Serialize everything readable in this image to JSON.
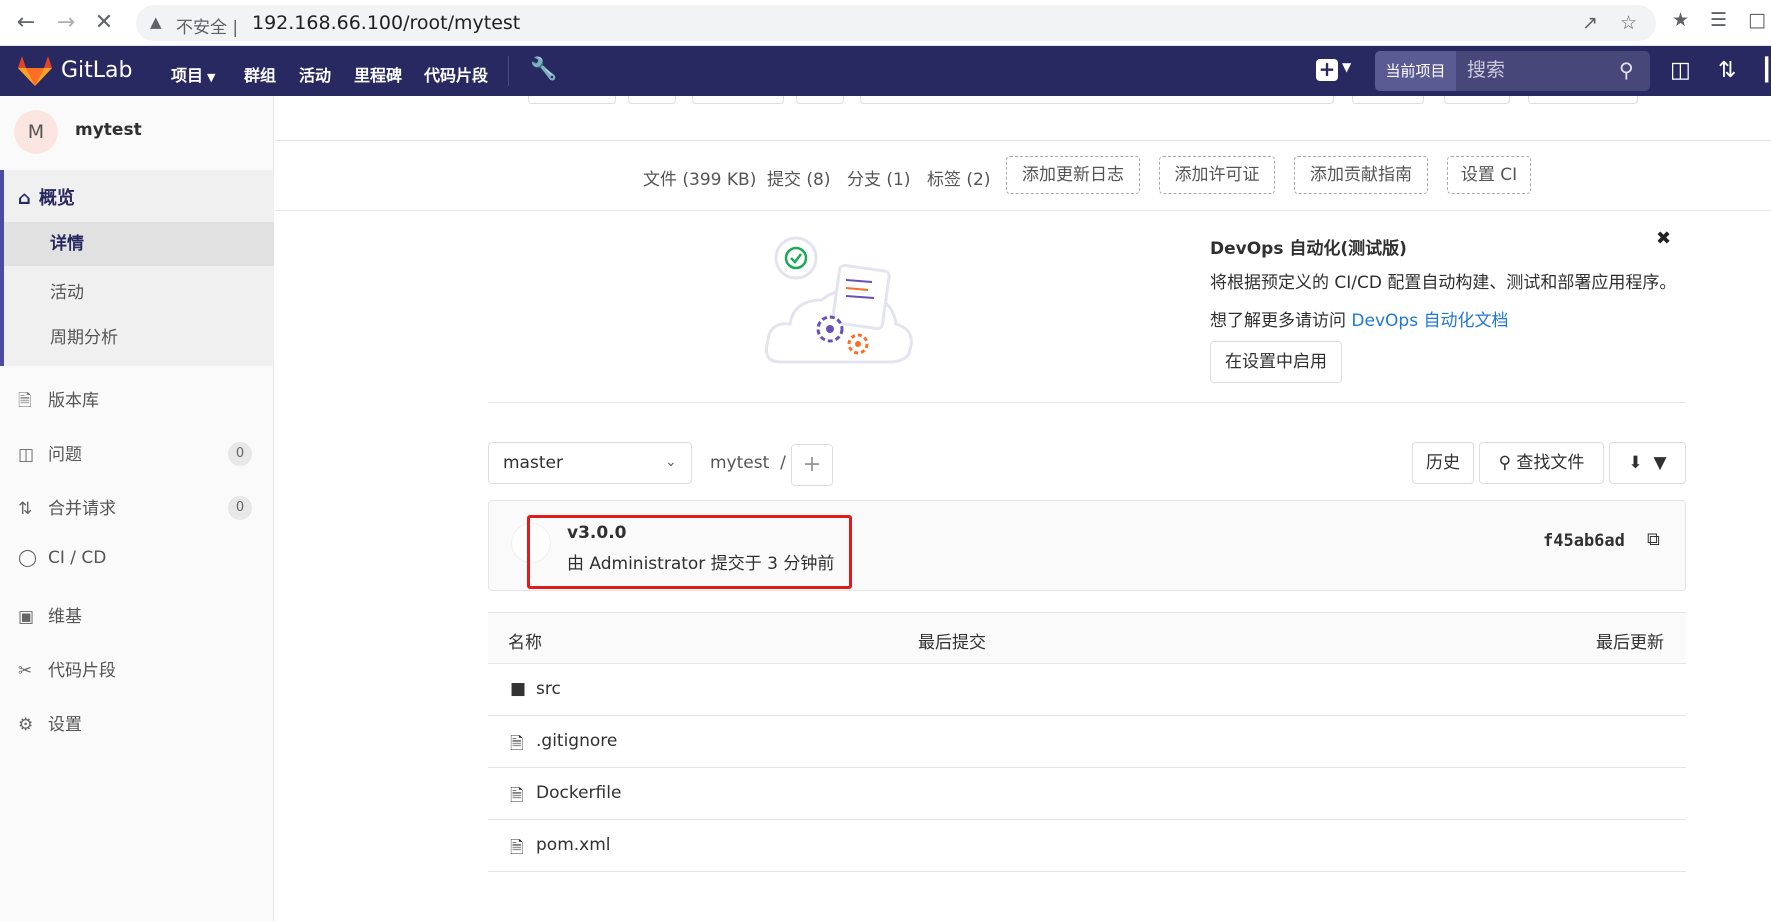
{
  "browser": {
    "insecure_label": "不安全 |",
    "url": "192.168.66.100/root/mytest"
  },
  "header": {
    "brand": "GitLab",
    "nav": [
      "项目",
      "群组",
      "活动",
      "里程碑",
      "代码片段"
    ],
    "search_scope": "当前项目",
    "search_placeholder": "搜索"
  },
  "sidebar": {
    "avatar_letter": "M",
    "project_name": "mytest",
    "overview": "概览",
    "overview_items": [
      "详情",
      "活动",
      "周期分析"
    ],
    "items": [
      {
        "label": "版本库",
        "icon": "document-icon"
      },
      {
        "label": "问题",
        "icon": "issues-icon",
        "badge": "0"
      },
      {
        "label": "合并请求",
        "icon": "merge-request-icon",
        "badge": "0"
      },
      {
        "label": "CI / CD",
        "icon": "rocket-icon"
      },
      {
        "label": "维基",
        "icon": "book-icon"
      },
      {
        "label": "代码片段",
        "icon": "scissors-icon"
      },
      {
        "label": "设置",
        "icon": "gear-icon"
      }
    ]
  },
  "stats": {
    "files": "文件 (399 KB)",
    "commits": "提交 (8)",
    "branches": "分支 (1)",
    "tags": "标签 (2)",
    "add_changelog": "添加更新日志",
    "add_license": "添加许可证",
    "add_contributing": "添加贡献指南",
    "setup_ci": "设置 CI"
  },
  "devops": {
    "title": "DevOps 自动化(测试版)",
    "desc": "将根据预定义的 CI/CD 配置自动构建、测试和部署应用程序。",
    "learn_prefix": "想了解更多请访问",
    "learn_link": "DevOps 自动化文档",
    "enable_button": "在设置中启用"
  },
  "repo": {
    "branch": "master",
    "path": "mytest",
    "path_sep": "/",
    "history": "历史",
    "find_file": "查找文件"
  },
  "commit": {
    "title": "v3.0.0",
    "meta": "由 Administrator 提交于 3 分钟前",
    "sha": "f45ab6ad"
  },
  "table": {
    "headers": {
      "name": "名称",
      "last_commit": "最后提交",
      "last_update": "最后更新"
    },
    "rows": [
      {
        "name": "src",
        "type": "folder"
      },
      {
        "name": ".gitignore",
        "type": "file"
      },
      {
        "name": "Dockerfile",
        "type": "file"
      },
      {
        "name": "pom.xml",
        "type": "file"
      }
    ]
  },
  "colors": {
    "header_bg": "#292961",
    "accent": "#1f78d1",
    "highlight": "#e01b1b"
  }
}
